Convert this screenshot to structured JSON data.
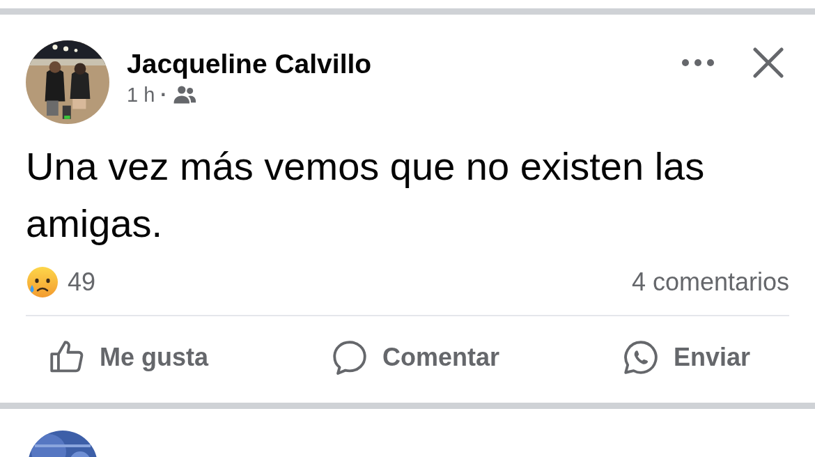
{
  "post": {
    "author": "Jacqueline Calvillo",
    "time": "1 h",
    "separator": "·",
    "text": "Una vez más vemos que no existen las amigas.",
    "reaction_count": "49",
    "comments": "4 comentarios"
  },
  "actions": [
    {
      "kind": "like",
      "label": "Me gusta"
    },
    {
      "kind": "comment",
      "label": "Comentar"
    },
    {
      "kind": "send",
      "label": "Enviar"
    }
  ]
}
